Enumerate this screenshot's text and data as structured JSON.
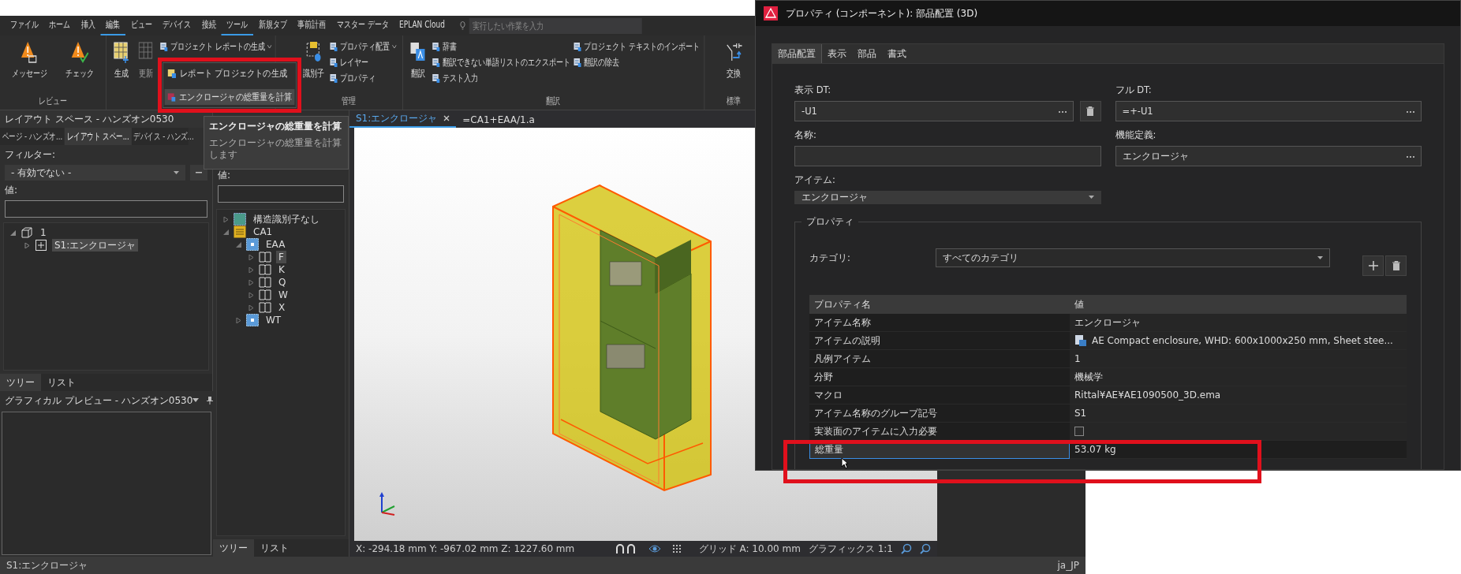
{
  "main_window": {
    "menu_tabs": [
      {
        "label": "ファイル",
        "selected": false
      },
      {
        "label": "ホーム",
        "selected": false
      },
      {
        "label": "挿入",
        "selected": false
      },
      {
        "label": "編集",
        "selected": true
      },
      {
        "label": "ビュー",
        "selected": false
      },
      {
        "label": "デバイス",
        "selected": false
      },
      {
        "label": "接続",
        "selected": false
      },
      {
        "label": "ツール",
        "selected": true
      },
      {
        "label": "新規タブ",
        "selected": false
      },
      {
        "label": "事前計画",
        "selected": false
      },
      {
        "label": "マスター データ",
        "selected": false
      },
      {
        "label": "EPLAN Cloud",
        "selected": false
      }
    ],
    "search": {
      "placeholder": "実行したい作業を入力"
    },
    "ribbon_groups": [
      {
        "label": "レビュー",
        "buttons": [
          {
            "label": "メッセージ",
            "kind": "large",
            "disabled": false
          },
          {
            "label": "チェック",
            "kind": "large",
            "disabled": false
          }
        ]
      },
      {
        "buttons": [
          {
            "label": "生成",
            "kind": "large",
            "disabled": false
          },
          {
            "label": "更新",
            "kind": "large",
            "disabled": true
          },
          {
            "label": "プロジェクト レポートの生成",
            "kind": "split",
            "disabled": false
          }
        ]
      },
      {
        "label": "管理",
        "buttons": [
          {
            "label": "識別子",
            "kind": "large",
            "disabled": false
          },
          {
            "label": "プロパティ配置",
            "kind": "split",
            "disabled": false
          },
          {
            "label": "レイヤー",
            "kind": "small",
            "disabled": false
          },
          {
            "label": "プロパティ",
            "kind": "small",
            "disabled": false
          }
        ]
      },
      {
        "label": "翻訳",
        "buttons": [
          {
            "label": "翻訳",
            "kind": "large",
            "disabled": false
          },
          {
            "label": "辞書",
            "kind": "small",
            "disabled": false
          },
          {
            "label": "翻訳できない単語リストのエクスポート",
            "kind": "small",
            "disabled": false
          },
          {
            "label": "テスト入力",
            "kind": "small",
            "disabled": false
          },
          {
            "label": "プロジェクト テキストのインポート",
            "kind": "small",
            "disabled": false
          },
          {
            "label": "翻訳の除去",
            "kind": "small",
            "disabled": false
          }
        ]
      },
      {
        "label": "標準",
        "buttons": [
          {
            "label": "交換",
            "kind": "large",
            "disabled": false
          }
        ]
      }
    ],
    "report_menu": {
      "items": [
        {
          "label": "レポート プロジェクトの生成",
          "selected": false
        },
        {
          "label": "エンクロージャの総重量を計算",
          "selected": true
        }
      ]
    },
    "tooltip": {
      "title": "エンクロージャの総重量を計算",
      "description": "エンクロージャの総重量を計算します"
    },
    "layout_panel": {
      "title": "レイアウト スペース - ハンズオン0530",
      "tabs": [
        {
          "label": "ページ - ハンズオ...",
          "selected": false
        },
        {
          "label": "レイアウト スペー...",
          "selected": true
        },
        {
          "label": "デバイス - ハンズ...",
          "selected": false
        }
      ],
      "filter_label": "フィルター:",
      "filter_value": "- 有効でない -",
      "value_label": "値:",
      "tree": [
        {
          "label": "1",
          "kind": "cube",
          "expanded": true,
          "selected": false,
          "children": [
            {
              "label": "S1:エンクロージャ",
              "kind": "enclosure",
              "expanded": false,
              "selected": true
            }
          ]
        }
      ],
      "bottom_tabs": [
        {
          "label": "ツリー",
          "selected": true
        },
        {
          "label": "リスト",
          "selected": false
        }
      ]
    },
    "preview_panel": {
      "title": "グラフィカル プレビュー - ハンズオン0530"
    },
    "structure_panel": {
      "value_label": "値:",
      "tree": [
        {
          "label": "構造識別子なし",
          "kind": "none",
          "expanded": false,
          "selected": false
        },
        {
          "label": "CA1",
          "kind": "installation",
          "expanded": true,
          "selected": false,
          "children": [
            {
              "label": "EAA",
              "kind": "location",
              "expanded": true,
              "selected": false,
              "children": [
                {
                  "label": "F",
                  "kind": "book",
                  "expanded": false,
                  "selected": true
                },
                {
                  "label": "K",
                  "kind": "book",
                  "expanded": false,
                  "selected": false
                },
                {
                  "label": "Q",
                  "kind": "book",
                  "expanded": false,
                  "selected": false
                },
                {
                  "label": "W",
                  "kind": "book",
                  "expanded": false,
                  "selected": false
                },
                {
                  "label": "X",
                  "kind": "book",
                  "expanded": false,
                  "selected": false
                }
              ]
            },
            {
              "label": "WT",
              "kind": "location",
              "expanded": false,
              "selected": false
            }
          ]
        }
      ],
      "bottom_tabs": [
        {
          "label": "ツリー",
          "selected": true
        },
        {
          "label": "リスト",
          "selected": false
        }
      ]
    },
    "view": {
      "tabs": [
        {
          "label": "S1:エンクロージャ",
          "selected": true
        },
        {
          "label": "=CA1+EAA/1.a",
          "selected": false
        }
      ],
      "coordinates": "X: -294.18 mm Y: -967.02 mm Z: 1227.60 mm",
      "grid": "グリッド A: 10.00 mm",
      "graphics": "グラフィックス 1:1"
    },
    "status_bar": {
      "left": "S1:エンクロージャ",
      "right": "ja_JP"
    }
  },
  "dialog": {
    "title": "プロパティ (コンポーネント): 部品配置 (3D)",
    "tabs": [
      {
        "label": "部品配置",
        "selected": true
      },
      {
        "label": "表示",
        "selected": false
      },
      {
        "label": "部品",
        "selected": false
      },
      {
        "label": "書式",
        "selected": false
      }
    ],
    "display_dt": {
      "label": "表示 DT:",
      "value": "-U1"
    },
    "full_dt": {
      "label": "フル DT:",
      "value": "=+-U1"
    },
    "name": {
      "label": "名称:"
    },
    "function_definition": {
      "label": "機能定義:",
      "value": "エンクロージャ"
    },
    "item": {
      "label": "アイテム:",
      "value": "エンクロージャ"
    },
    "properties": {
      "title": "プロパティ",
      "category_label": "カテゴリ:",
      "category_value": "すべてのカテゴリ",
      "columns": [
        "プロパティ名",
        "値"
      ],
      "rows": [
        {
          "name": "アイテム名称",
          "value": "エンクロージャ",
          "kind": "text",
          "selected": false
        },
        {
          "name": "アイテムの説明",
          "value": "AE Compact enclosure, WHD: 600x1000x250 mm, Sheet stee...",
          "kind": "document",
          "selected": false
        },
        {
          "name": "凡例アイテム",
          "value": "1",
          "kind": "text",
          "selected": false
        },
        {
          "name": "分野",
          "value": "機械学",
          "kind": "text",
          "selected": false
        },
        {
          "name": "マクロ",
          "value": "Rittal¥AE¥AE1090500_3D.ema",
          "kind": "text",
          "selected": false
        },
        {
          "name": "アイテム名称のグループ記号",
          "value": "S1",
          "kind": "text",
          "selected": false
        },
        {
          "name": "実装面のアイテムに入力必要",
          "kind": "checkbox",
          "checked": false,
          "selected": false
        },
        {
          "name": "総重量",
          "value": "53.07 kg",
          "kind": "text",
          "selected": true
        }
      ]
    }
  }
}
